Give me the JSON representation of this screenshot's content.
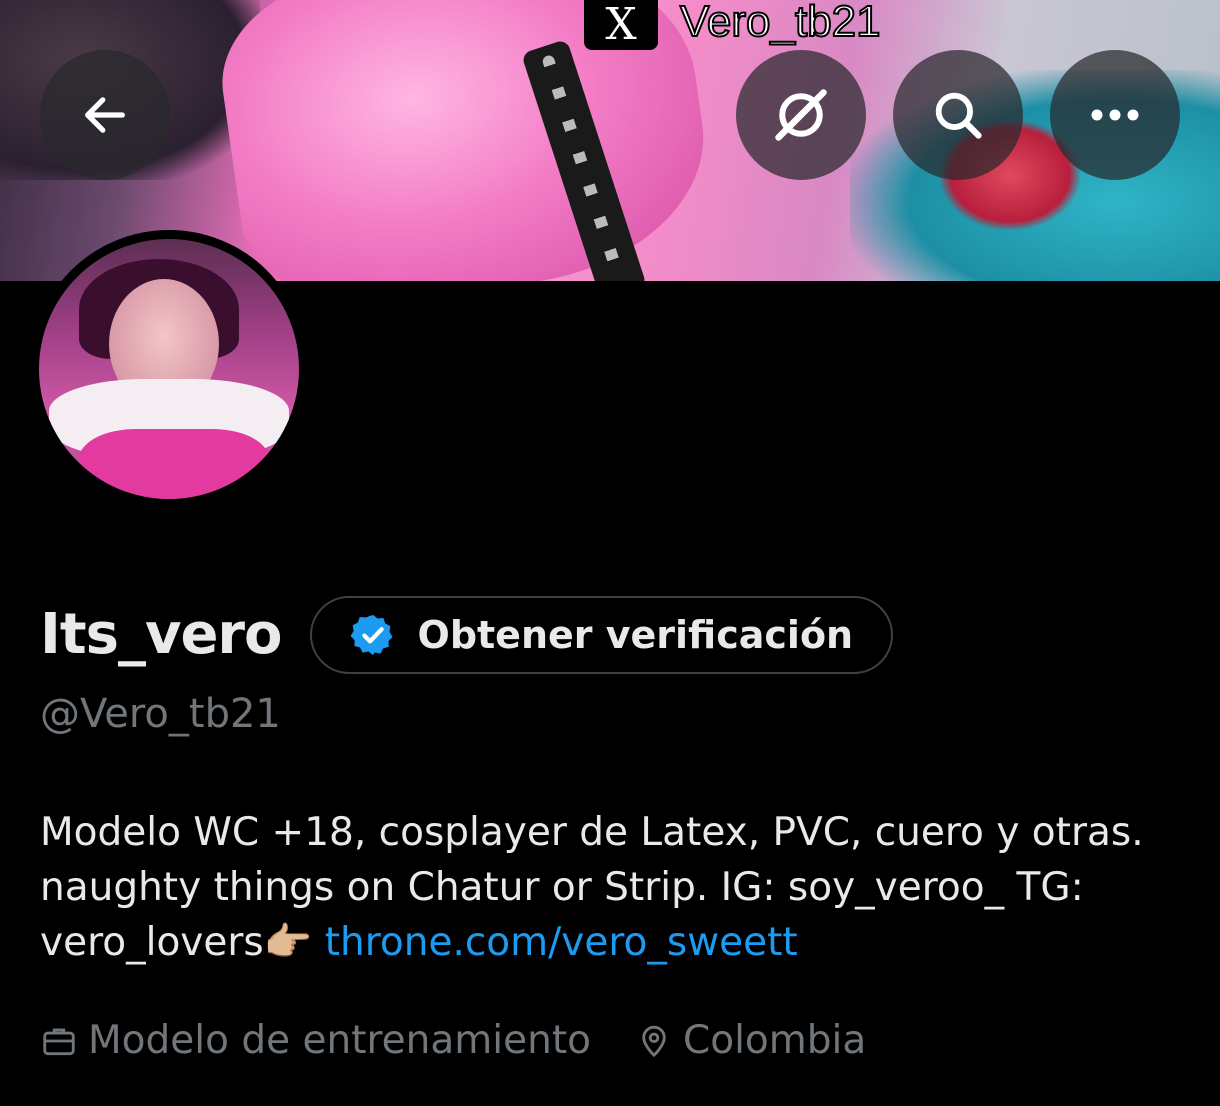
{
  "banner": {
    "watermark_logo": "X",
    "watermark_handle": "Vero_tb21"
  },
  "toolbar": {
    "back_icon": "arrow-left-icon",
    "grok_icon": "grok-icon",
    "search_icon": "search-icon",
    "more_icon": "more-horizontal-icon"
  },
  "profile": {
    "display_name": "Its_vero",
    "verify_label": "Obtener verificación",
    "username": "@Vero_tb21",
    "bio_text": "Modelo WC +18, cosplayer de Latex, PVC, cuero y otras. naughty things on Chatur or Strip.  IG: soy_veroo_ TG: vero_lovers👉🏼 ",
    "bio_link": "throne.com/vero_sweett",
    "profession": "Modelo de entrenamiento",
    "location": "Colombia"
  },
  "colors": {
    "background": "#000000",
    "text_primary": "#e7e9ea",
    "text_secondary": "#71767b",
    "link": "#1d9bf0",
    "verified_badge": "#1d9bf0"
  }
}
